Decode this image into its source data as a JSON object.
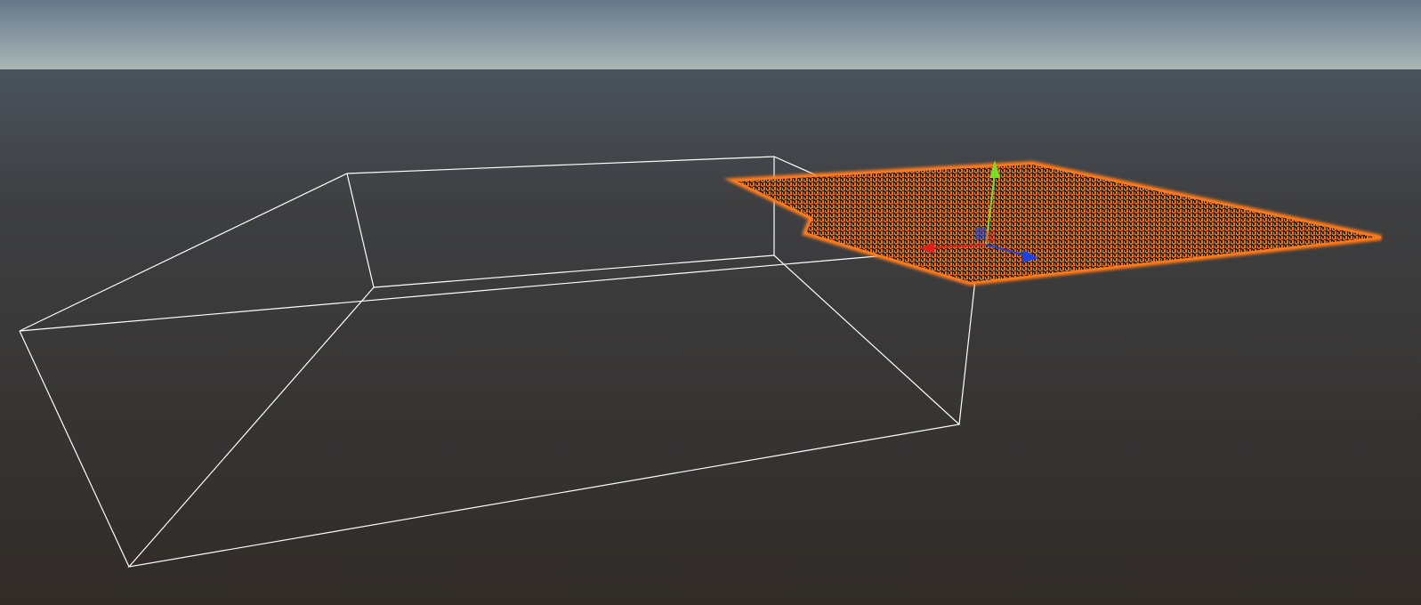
{
  "scene": {
    "colors": {
      "selection_outline": "#ff7a1a",
      "points": "#ff6a00",
      "wireframe": "#ffffff",
      "gizmo_x": "#e02020",
      "gizmo_y": "#7cdc20",
      "gizmo_z": "#2040e0"
    },
    "icons": [
      "move-gizmo-icon"
    ]
  }
}
